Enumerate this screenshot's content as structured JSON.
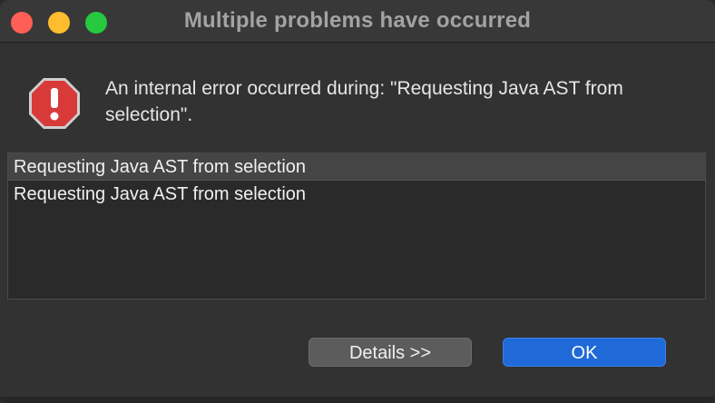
{
  "window": {
    "title": "Multiple problems have occurred"
  },
  "dialog": {
    "icon": "error-icon",
    "message": "An internal error occurred during: \"Requesting Java AST from selection\".",
    "problems": [
      "Requesting Java AST from selection",
      "Requesting Java AST from selection"
    ],
    "selected_index": 0
  },
  "buttons": {
    "details_label": "Details >>",
    "ok_label": "OK"
  },
  "colors": {
    "accent": "#1f6ad8",
    "error_red": "#d83a3a",
    "traffic_close": "#ff5f57",
    "traffic_min": "#febc2e",
    "traffic_max": "#28c840"
  }
}
